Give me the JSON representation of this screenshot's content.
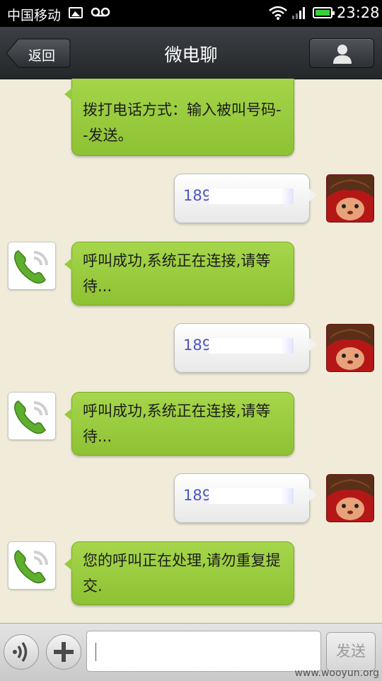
{
  "status_bar": {
    "carrier": "中国移动",
    "time": "23:28",
    "icons": [
      "image-icon",
      "voicemail-icon",
      "wifi-icon",
      "signal-icon",
      "battery-icon"
    ],
    "battery_color": "#39d13a"
  },
  "header": {
    "back_label": "返回",
    "title": "微电聊",
    "profile_icon": "person-icon"
  },
  "messages": [
    {
      "side": "incoming",
      "sender_icon": "phone-icon",
      "text": "拨打电话方式：输入被叫号码--发送。"
    },
    {
      "side": "outgoing",
      "sender_icon": "monchhichi-avatar",
      "text": "189"
    },
    {
      "side": "incoming",
      "sender_icon": "phone-icon",
      "text": "呼叫成功,系统正在连接,请等待..."
    },
    {
      "side": "outgoing",
      "sender_icon": "monchhichi-avatar",
      "text": "189"
    },
    {
      "side": "incoming",
      "sender_icon": "phone-icon",
      "text": "呼叫成功,系统正在连接,请等待..."
    },
    {
      "side": "outgoing",
      "sender_icon": "monchhichi-avatar",
      "text": "189"
    },
    {
      "side": "incoming",
      "sender_icon": "phone-icon",
      "text": "您的呼叫正在处理,请勿重复提交."
    }
  ],
  "input_bar": {
    "voice_icon": "voice-icon",
    "plus_icon": "plus-icon",
    "input_value": "",
    "send_label": "发送"
  },
  "colors": {
    "incoming_bubble": "#96ca3b",
    "outgoing_text": "#4e56c2",
    "chat_background": "#f1ecd9"
  },
  "watermark": "www.wooyun.org"
}
